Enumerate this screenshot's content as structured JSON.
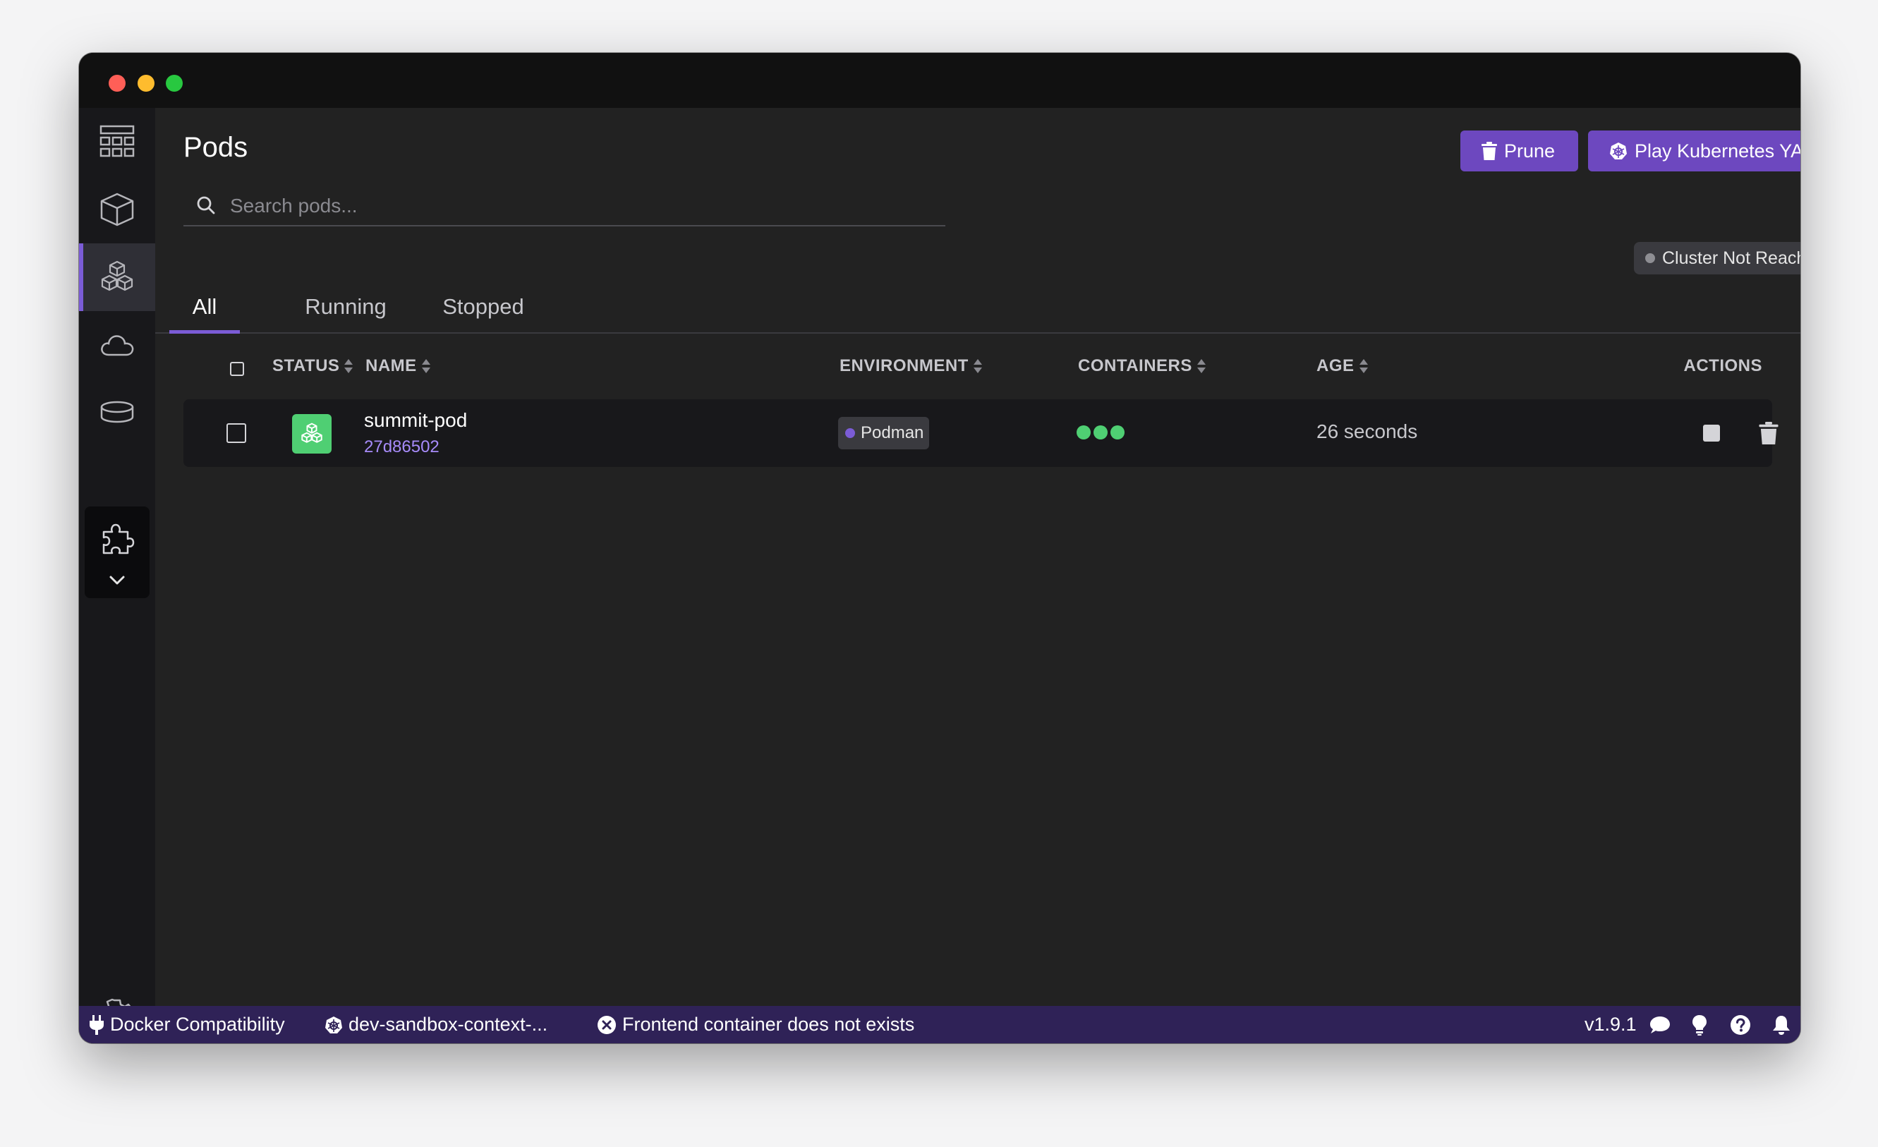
{
  "page": {
    "title": "Pods",
    "search_placeholder": "Search pods...",
    "prune_label": "Prune",
    "play_label": "Play Kubernetes YAML",
    "cluster_status": "Cluster Not Reachable"
  },
  "tabs": [
    {
      "label": "All",
      "active": true
    },
    {
      "label": "Running",
      "active": false
    },
    {
      "label": "Stopped",
      "active": false
    }
  ],
  "table": {
    "columns": {
      "status": "STATUS",
      "name": "NAME",
      "environment": "ENVIRONMENT",
      "containers": "CONTAINERS",
      "age": "AGE",
      "actions": "ACTIONS"
    },
    "rows": [
      {
        "name": "summit-pod",
        "id": "27d86502",
        "environment": "Podman",
        "container_count": 3,
        "age": "26 seconds"
      }
    ]
  },
  "sidebar": {
    "items": [
      {
        "icon": "dashboard-icon"
      },
      {
        "icon": "containers-icon"
      },
      {
        "icon": "pods-icon",
        "active": true
      },
      {
        "icon": "kubernetes-cloud-icon"
      },
      {
        "icon": "volumes-icon"
      },
      {
        "icon": "extensions-icon"
      }
    ]
  },
  "statusbar": {
    "docker_compat": "Docker Compatibility",
    "context": "dev-sandbox-context-...",
    "error": "Frontend container does not exists",
    "version": "v1.9.1"
  },
  "colors": {
    "accent": "#6d48bf",
    "running": "#4fcf73",
    "statusbar": "#2f2257"
  }
}
